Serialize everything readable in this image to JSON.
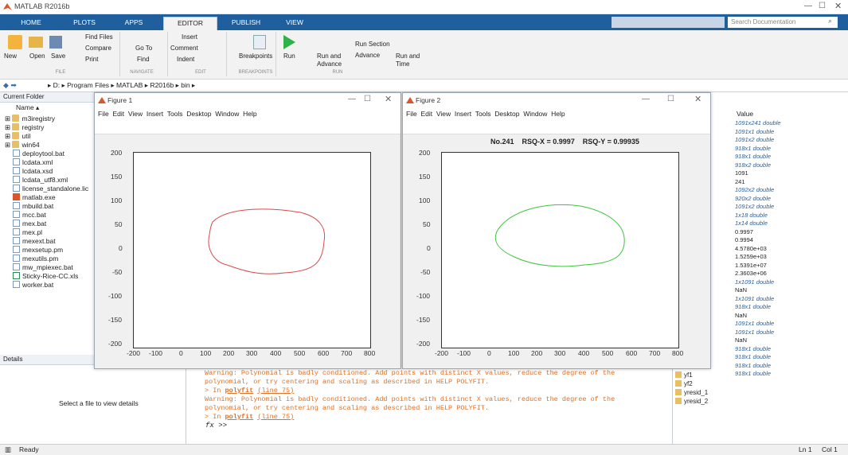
{
  "app": {
    "title": "MATLAB R2016b"
  },
  "tabs": [
    {
      "label": "HOME"
    },
    {
      "label": "PLOTS"
    },
    {
      "label": "APPS"
    },
    {
      "label": "EDITOR"
    },
    {
      "label": "PUBLISH"
    },
    {
      "label": "VIEW"
    }
  ],
  "search": {
    "placeholder": "Search Documentation"
  },
  "ribbon": {
    "find_files": "Find Files",
    "compare": "Compare",
    "print": "Print",
    "go_to": "Go To",
    "find": "Find",
    "insert": "Insert",
    "comment": "Comment",
    "indent": "Indent",
    "new": "New",
    "open": "Open",
    "save": "Save",
    "breakpoints": "Breakpoints",
    "run": "Run",
    "run_and_advance": "Run and\nAdvance",
    "run_section": "Run Section",
    "advance": "Advance",
    "run_and_time": "Run and\nTime",
    "sections": [
      "FILE",
      "NAVIGATE",
      "EDIT",
      "BREAKPOINTS",
      "RUN"
    ]
  },
  "address": {
    "path": [
      "D:",
      "Program Files",
      "MATLAB",
      "R2016b",
      "bin"
    ]
  },
  "current_folder": {
    "title": "Current Folder",
    "column": "Name",
    "items": [
      {
        "name": "m3iregistry",
        "kind": "folder"
      },
      {
        "name": "registry",
        "kind": "folder"
      },
      {
        "name": "util",
        "kind": "folder"
      },
      {
        "name": "win64",
        "kind": "folder"
      },
      {
        "name": "deploytool.bat",
        "kind": "file"
      },
      {
        "name": "lcdata.xml",
        "kind": "file"
      },
      {
        "name": "lcdata.xsd",
        "kind": "file"
      },
      {
        "name": "lcdata_utf8.xml",
        "kind": "file"
      },
      {
        "name": "license_standalone.lic",
        "kind": "file"
      },
      {
        "name": "matlab.exe",
        "kind": "exe"
      },
      {
        "name": "mbuild.bat",
        "kind": "file"
      },
      {
        "name": "mcc.bat",
        "kind": "file"
      },
      {
        "name": "mex.bat",
        "kind": "file"
      },
      {
        "name": "mex.pl",
        "kind": "file"
      },
      {
        "name": "mexext.bat",
        "kind": "file"
      },
      {
        "name": "mexsetup.pm",
        "kind": "file"
      },
      {
        "name": "mexutils.pm",
        "kind": "file"
      },
      {
        "name": "mw_mpiexec.bat",
        "kind": "file"
      },
      {
        "name": "Sticky-Rice-CC.xls",
        "kind": "xls"
      },
      {
        "name": "worker.bat",
        "kind": "file"
      }
    ]
  },
  "details": {
    "title": "Details",
    "message": "Select a file to view details"
  },
  "fig1": {
    "title": "Figure 1",
    "menu": [
      "File",
      "Edit",
      "View",
      "Insert",
      "Tools",
      "Desktop",
      "Window",
      "Help"
    ],
    "plot_title": "",
    "yticks": [
      "200",
      "150",
      "100",
      "50",
      "0",
      "-50",
      "-100",
      "-150",
      "-200"
    ],
    "xticks": [
      "-200",
      "-100",
      "0",
      "100",
      "200",
      "300",
      "400",
      "500",
      "600",
      "700",
      "800"
    ],
    "curve_color": "#d94a4a"
  },
  "fig2": {
    "title": "Figure 2",
    "menu": [
      "File",
      "Edit",
      "View",
      "Insert",
      "Tools",
      "Desktop",
      "Window",
      "Help"
    ],
    "plot_title": "No.241    RSQ-X = 0.9997    RSQ-Y = 0.99935",
    "yticks": [
      "200",
      "150",
      "100",
      "50",
      "0",
      "-50",
      "-100",
      "-150",
      "-200"
    ],
    "xticks": [
      "-200",
      "-100",
      "0",
      "100",
      "200",
      "300",
      "400",
      "500",
      "600",
      "700",
      "800"
    ],
    "curve_color": "#3ec43e"
  },
  "chart_data": [
    {
      "type": "line",
      "series": [
        {
          "values": "closed contour"
        }
      ],
      "xlim": [
        -200,
        800
      ],
      "ylim": [
        -200,
        200
      ]
    },
    {
      "type": "line",
      "title": "No.241    RSQ-X = 0.9997    RSQ-Y = 0.99935",
      "xlim": [
        -200,
        800
      ],
      "ylim": [
        -200,
        200
      ]
    }
  ],
  "workspace": {
    "header": "Value",
    "values": [
      "1091x241 double",
      "1091x1 double",
      "1091x2 double",
      "918x1 double",
      "918x1 double",
      "918x2 double",
      "1091",
      "241",
      "1092x2 double",
      "920x2 double",
      "1091x2 double",
      "1x18 double",
      "1x14 double",
      "0.9997",
      "0.9994",
      "4.5780e+03",
      "1.5259e+03",
      "1.5391e+07",
      "2.3603e+06",
      "1x1091 double",
      "NaN",
      "1x1091 double",
      "918x1 double",
      "NaN",
      "1091x1 double",
      "1091x1 double",
      "NaN",
      "918x1 double",
      "918x1 double",
      "918x1 double",
      "918x1 double"
    ],
    "names": [
      "yf1",
      "yf2",
      "yresid_1",
      "yresid_2"
    ]
  },
  "console": {
    "w1": "Warning: Polynomial is badly conditioned. Add points with distinct X values, reduce the degree of the",
    "w2": "polynomial, or try centering and scaling as described in HELP POLYFIT.",
    "in_prefix": "> In ",
    "fn": "polyfit",
    "line": "(line 75)",
    "prompt": ">>",
    "fx": "fx"
  },
  "status": {
    "text": "Ready",
    "ln": "Ln 1",
    "col": "Col 1"
  }
}
